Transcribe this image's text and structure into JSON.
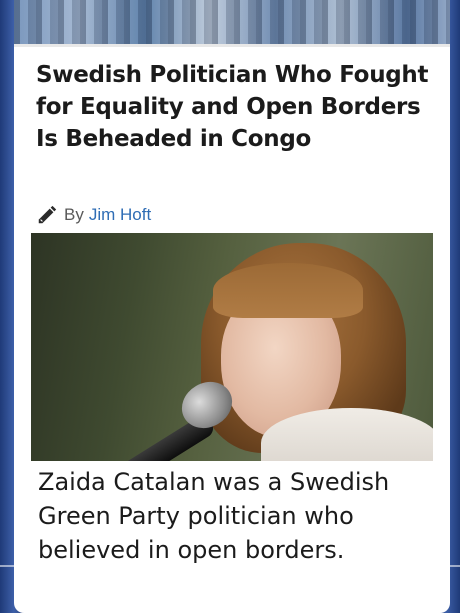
{
  "article": {
    "headline": "Swedish Politician Who Fought for Equality and Open Borders Is Beheaded in Congo",
    "byline_prefix": "By",
    "author": "Jim Hoft",
    "caption": "Zaida Catalan was a Swedish Green Party politician who believed in open borders."
  },
  "icons": {
    "byline": "pencil-icon"
  },
  "colors": {
    "author_link": "#2f6db5",
    "headline": "#1b1b1b",
    "background": "#2b3f6e"
  }
}
